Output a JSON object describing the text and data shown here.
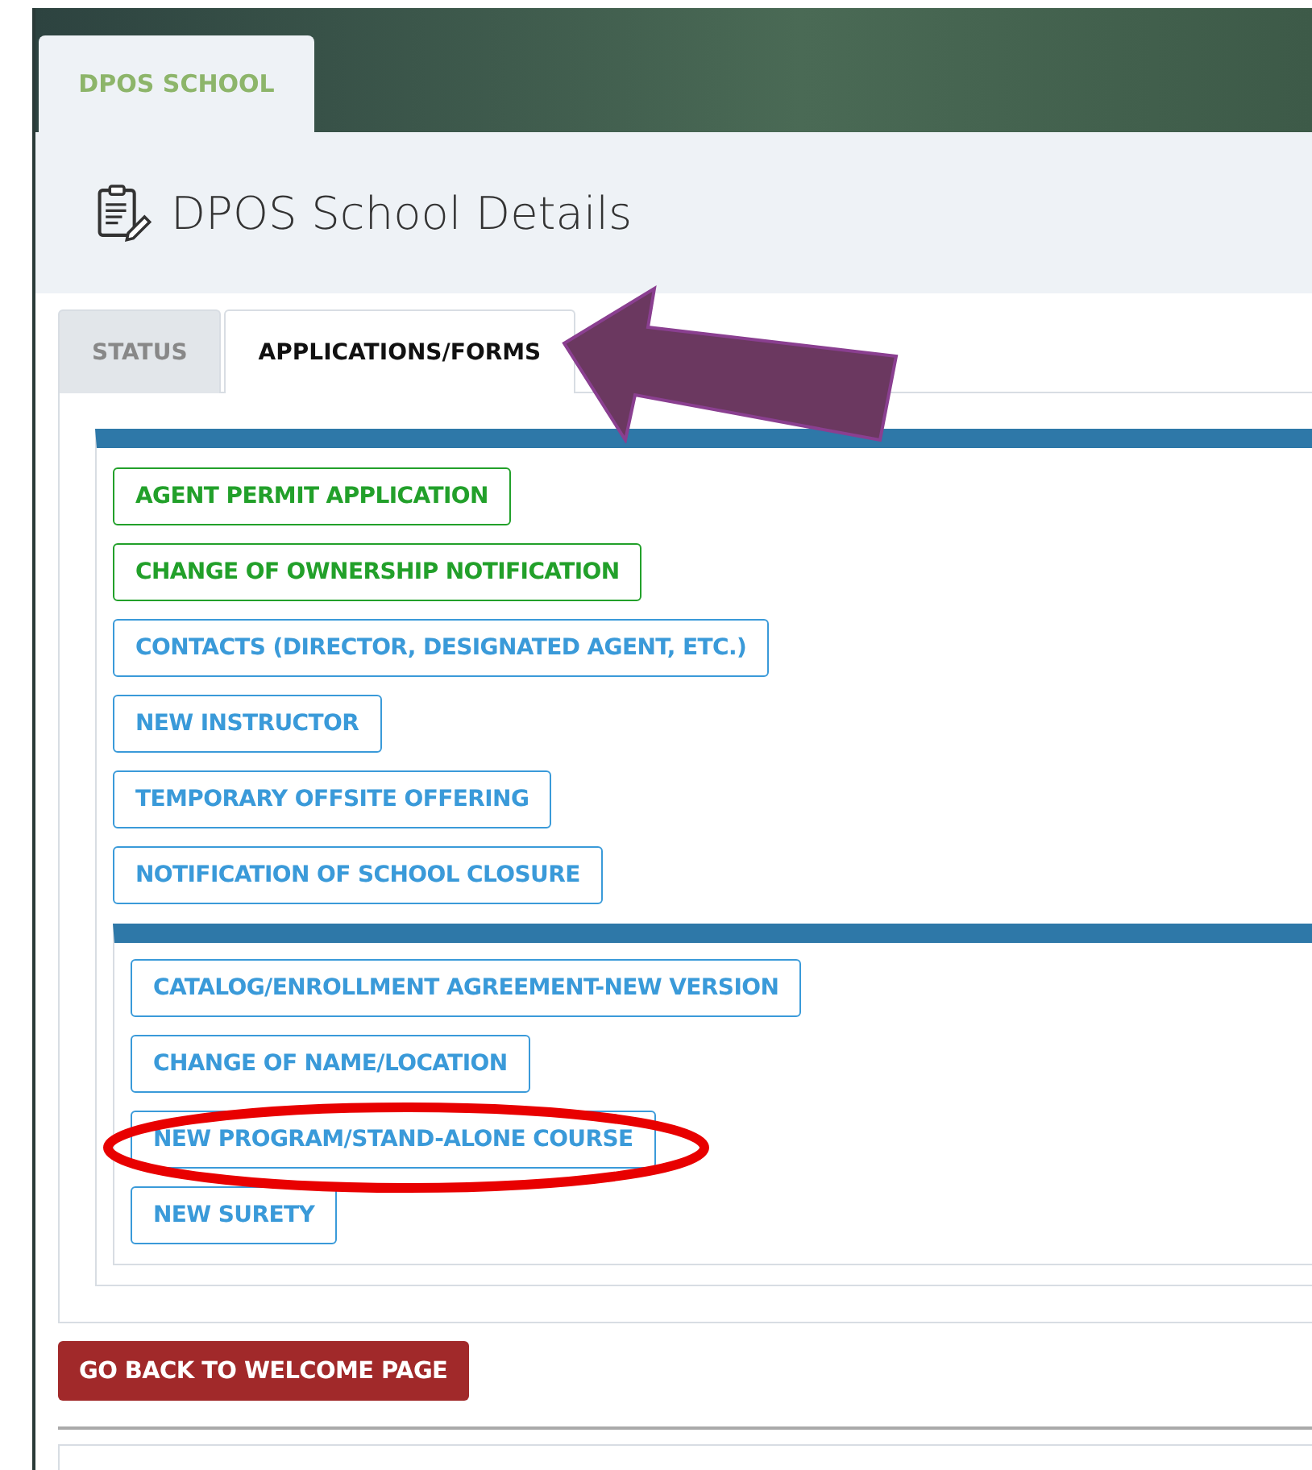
{
  "header_tab": {
    "label": "DPOS SCHOOL"
  },
  "page_title": "DPOS School Details",
  "tabs": [
    {
      "label": "STATUS",
      "selected": false
    },
    {
      "label": "APPLICATIONS/FORMS",
      "selected": true
    }
  ],
  "form_buttons": [
    {
      "label": "AGENT PERMIT APPLICATION",
      "color": "#22a02a"
    },
    {
      "label": "CHANGE OF OWNERSHIP NOTIFICATION",
      "color": "#22a02a"
    },
    {
      "label": "CONTACTS (DIRECTOR, DESIGNATED AGENT, ETC.)",
      "color": "#3a9ad9"
    },
    {
      "label": "NEW INSTRUCTOR",
      "color": "#3a9ad9"
    },
    {
      "label": "TEMPORARY OFFSITE OFFERING",
      "color": "#3a9ad9"
    },
    {
      "label": "NOTIFICATION OF SCHOOL CLOSURE",
      "color": "#3a9ad9"
    }
  ],
  "program_buttons": [
    {
      "label": "CATALOG/ENROLLMENT AGREEMENT-NEW VERSION",
      "color": "#3a9ad9"
    },
    {
      "label": "CHANGE OF NAME/LOCATION",
      "color": "#3a9ad9"
    },
    {
      "label": "NEW PROGRAM/STAND-ALONE COURSE",
      "color": "#3a9ad9"
    },
    {
      "label": "NEW SURETY",
      "color": "#3a9ad9"
    }
  ],
  "back_button": "GO BACK TO WELCOME PAGE"
}
